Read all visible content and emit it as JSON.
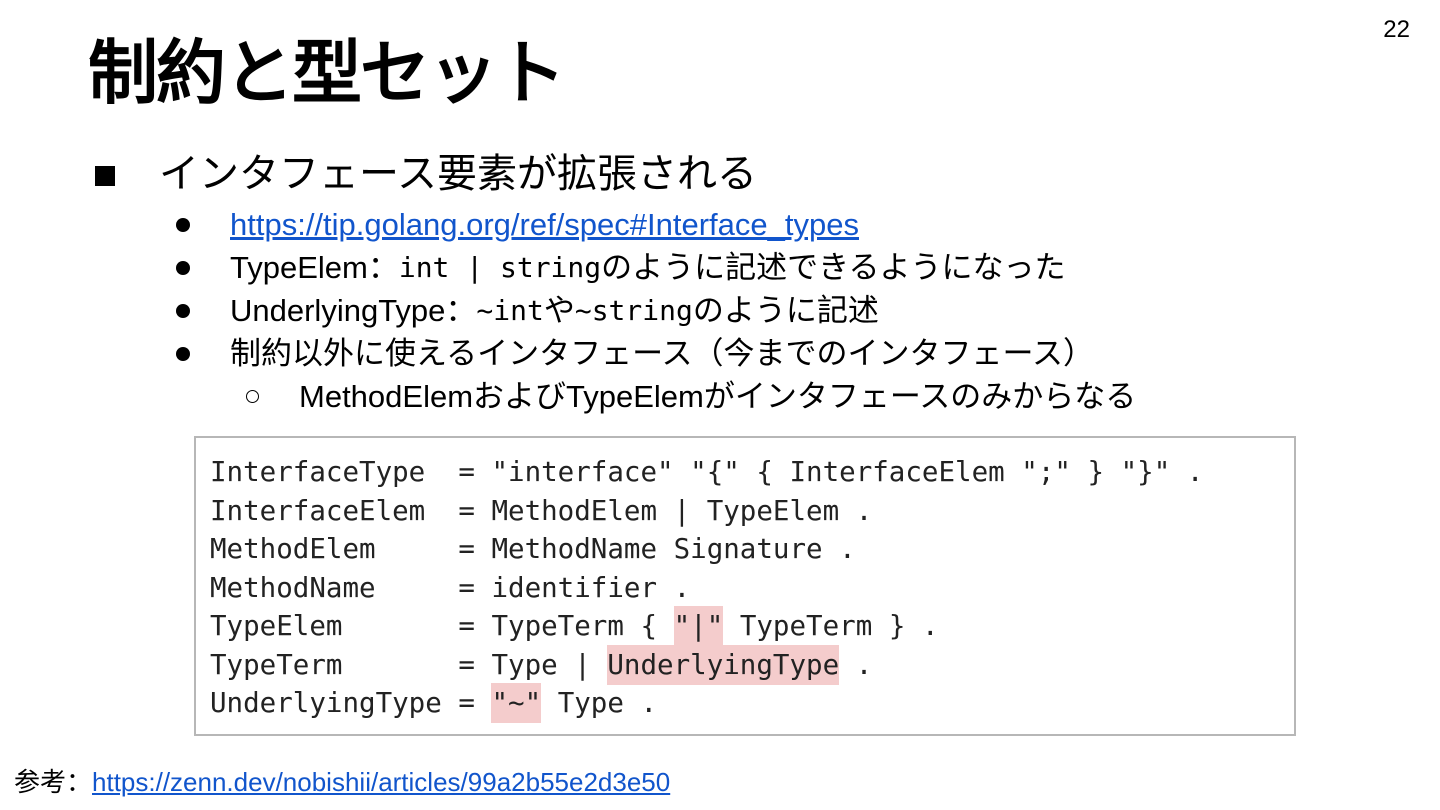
{
  "slide_number": "22",
  "title": "制約と型セット",
  "bullet_main": "インタフェース要素が拡張される",
  "sub_bullets": {
    "link": "https://tip.golang.org/ref/spec#Interface_types",
    "typeelem": {
      "a": "TypeElem：",
      "b": "int | string",
      "c": "のように記述できるようになった"
    },
    "underlying": {
      "a": "UnderlyingType：",
      "b": "~int",
      "c": "や",
      "d": "~string",
      "e": "のように記述"
    },
    "usage": "制約以外に使えるインタフェース（今までのインタフェース）",
    "nested": "MethodElemおよびTypeElemがインタフェースのみからなる"
  },
  "code": {
    "line1": "InterfaceType  = \"interface\" \"{\" { InterfaceElem \";\" } \"}\" .",
    "line2": "InterfaceElem  = MethodElem | TypeElem .",
    "line3": "MethodElem     = MethodName Signature .",
    "line4": "MethodName     = identifier .",
    "line5": {
      "pre": "TypeElem       = TypeTerm { ",
      "hl": "\"|\"",
      "post": " TypeTerm } ."
    },
    "line6": {
      "pre": "TypeTerm       = Type | ",
      "hl": "UnderlyingType",
      "post": " ."
    },
    "line7": {
      "pre": "UnderlyingType = ",
      "hl": "\"~\"",
      "post": " Type ."
    }
  },
  "reference": {
    "label": "参考：",
    "link": "https://zenn.dev/nobishii/articles/99a2b55e2d3e50"
  },
  "colors": {
    "link": "#1155cc",
    "highlight": "#f4cccc",
    "code_border": "#b7b7b7"
  }
}
